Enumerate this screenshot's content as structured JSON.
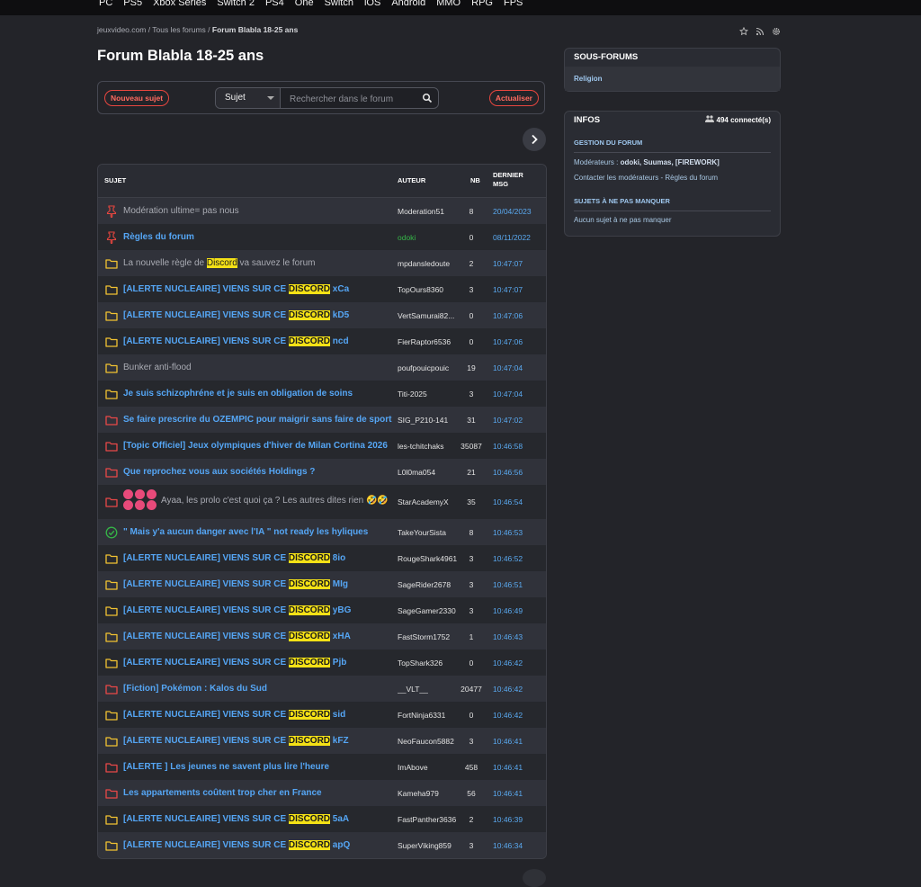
{
  "topnav": [
    "PC",
    "PS5",
    "Xbox Series",
    "Switch 2",
    "PS4",
    "One",
    "Switch",
    "iOS",
    "Android",
    "MMO",
    "RPG",
    "FPS"
  ],
  "breadcrumb": {
    "home": "jeuxvideo.com",
    "all": "Tous les forums",
    "current": "Forum Blabla 18-25 ans"
  },
  "page_title": "Forum Blabla 18-25 ans",
  "toolbar": {
    "new_topic": "Nouveau sujet",
    "select_value": "Sujet",
    "search_placeholder": "Rechercher dans le forum",
    "refresh": "Actualiser"
  },
  "table_headers": {
    "subject": "SUJET",
    "author": "AUTEUR",
    "nb": "NB",
    "last_1": "DERNIER",
    "last_2": "MSG"
  },
  "topics": [
    {
      "pre": "Modération ultime= pas nous",
      "hl": "",
      "post": "",
      "author": "Moderation51",
      "nb": "8",
      "date": "20/04/2023",
      "icon": "pin-icon",
      "style": "grey"
    },
    {
      "pre": "Règles du forum",
      "hl": "",
      "post": "",
      "author": "odoki",
      "nb": "0",
      "date": "08/11/2022",
      "icon": "pin-icon",
      "style": "blue",
      "author_style": "green"
    },
    {
      "pre": "La nouvelle règle de ",
      "hl": "Discord",
      "post": " va sauvez le forum",
      "author": "mpdansledoute",
      "nb": "2",
      "date": "10:47:07",
      "icon": "folder-yellow-icon",
      "style": "grey"
    },
    {
      "pre": "[ALERTE NUCLEAIRE] VIENS SUR CE ",
      "hl": "DISCORD",
      "post": " xCa",
      "author": "TopOurs8360",
      "nb": "3",
      "date": "10:47:07",
      "icon": "folder-yellow-icon",
      "style": "blue"
    },
    {
      "pre": "[ALERTE NUCLEAIRE] VIENS SUR CE ",
      "hl": "DISCORD",
      "post": " kD5",
      "author": "VertSamurai82...",
      "nb": "0",
      "date": "10:47:06",
      "icon": "folder-yellow-icon",
      "style": "blue"
    },
    {
      "pre": "[ALERTE NUCLEAIRE] VIENS SUR CE ",
      "hl": "DISCORD",
      "post": " ncd",
      "author": "FierRaptor6536",
      "nb": "0",
      "date": "10:47:06",
      "icon": "folder-yellow-icon",
      "style": "blue"
    },
    {
      "pre": "Bunker anti-flood",
      "hl": "",
      "post": "",
      "author": "poufpouicpouic",
      "nb": "19",
      "date": "10:47:04",
      "icon": "folder-yellow-icon",
      "style": "grey"
    },
    {
      "pre": "Je suis schizophréne et je suis en obligation de soins",
      "hl": "",
      "post": "",
      "author": "Titi-2025",
      "nb": "3",
      "date": "10:47:04",
      "icon": "folder-yellow-icon",
      "style": "blue"
    },
    {
      "pre": "Se faire prescrire du OZEMPIC pour maigrir sans faire de sport",
      "hl": "",
      "post": "",
      "author": "SIG_P210-141",
      "nb": "31",
      "date": "10:47:02",
      "icon": "folder-red-icon",
      "style": "blue"
    },
    {
      "pre": "[Topic Officiel] Jeux olympiques d'hiver de Milan Cortina 2026",
      "hl": "",
      "post": "",
      "author": "les-tchitchaks",
      "nb": "35087",
      "date": "10:46:58",
      "icon": "folder-red-icon",
      "style": "blue"
    },
    {
      "pre": "Que reprochez vous aux sociétés Holdings ?",
      "hl": "",
      "post": "",
      "author": "L0l0ma054",
      "nb": "21",
      "date": "10:46:56",
      "icon": "folder-red-icon",
      "style": "blue"
    },
    {
      "pre": "Ayaa, les prolo c'est quoi ça ? Les autres dites rien 🤣🤣",
      "hl": "",
      "post": "",
      "author": "StarAcademyX",
      "nb": "35",
      "date": "10:46:54",
      "icon": "folder-red-icon",
      "style": "grey",
      "emoji_row": true
    },
    {
      "pre": "\" Mais y'a aucun danger avec l'IA \" not ready les hyliques",
      "hl": "",
      "post": "",
      "author": "TakeYourSista",
      "nb": "8",
      "date": "10:46:53",
      "icon": "check-circle-icon",
      "style": "blue"
    },
    {
      "pre": "[ALERTE NUCLEAIRE] VIENS SUR CE ",
      "hl": "DISCORD",
      "post": " 8io",
      "author": "RougeShark4961",
      "nb": "3",
      "date": "10:46:52",
      "icon": "folder-yellow-icon",
      "style": "blue"
    },
    {
      "pre": "[ALERTE NUCLEAIRE] VIENS SUR CE ",
      "hl": "DISCORD",
      "post": " MIg",
      "author": "SageRider2678",
      "nb": "3",
      "date": "10:46:51",
      "icon": "folder-yellow-icon",
      "style": "blue"
    },
    {
      "pre": "[ALERTE NUCLEAIRE] VIENS SUR CE ",
      "hl": "DISCORD",
      "post": " yBG",
      "author": "SageGamer2330",
      "nb": "3",
      "date": "10:46:49",
      "icon": "folder-yellow-icon",
      "style": "blue"
    },
    {
      "pre": "[ALERTE NUCLEAIRE] VIENS SUR CE ",
      "hl": "DISCORD",
      "post": " xHA",
      "author": "FastStorm1752",
      "nb": "1",
      "date": "10:46:43",
      "icon": "folder-yellow-icon",
      "style": "blue"
    },
    {
      "pre": "[ALERTE NUCLEAIRE] VIENS SUR CE ",
      "hl": "DISCORD",
      "post": " Pjb",
      "author": "TopShark326",
      "nb": "0",
      "date": "10:46:42",
      "icon": "folder-yellow-icon",
      "style": "blue"
    },
    {
      "pre": "[Fiction] Pokémon : Kalos du Sud",
      "hl": "",
      "post": "",
      "author": "__VLT__",
      "nb": "20477",
      "date": "10:46:42",
      "icon": "folder-red-icon",
      "style": "blue"
    },
    {
      "pre": "[ALERTE NUCLEAIRE] VIENS SUR CE ",
      "hl": "DISCORD",
      "post": " sid",
      "author": "FortNinja6331",
      "nb": "0",
      "date": "10:46:42",
      "icon": "folder-yellow-icon",
      "style": "blue"
    },
    {
      "pre": "[ALERTE NUCLEAIRE] VIENS SUR CE ",
      "hl": "DISCORD",
      "post": " kFZ",
      "author": "NeoFaucon5882",
      "nb": "3",
      "date": "10:46:41",
      "icon": "folder-yellow-icon",
      "style": "blue"
    },
    {
      "pre": "[ALERTE ] Les jeunes ne savent plus lire l'heure",
      "hl": "",
      "post": "",
      "author": "ImAbove",
      "nb": "458",
      "date": "10:46:41",
      "icon": "folder-red-icon",
      "style": "blue"
    },
    {
      "pre": "Les appartements coûtent trop cher en France",
      "hl": "",
      "post": "",
      "author": "Kameha979",
      "nb": "56",
      "date": "10:46:41",
      "icon": "folder-red-icon",
      "style": "blue"
    },
    {
      "pre": "[ALERTE NUCLEAIRE] VIENS SUR CE ",
      "hl": "DISCORD",
      "post": " 5aA",
      "author": "FastPanther3636",
      "nb": "2",
      "date": "10:46:39",
      "icon": "folder-yellow-icon",
      "style": "blue"
    },
    {
      "pre": "[ALERTE NUCLEAIRE] VIENS SUR CE ",
      "hl": "DISCORD",
      "post": " apQ",
      "author": "SuperViking859",
      "nb": "3",
      "date": "10:46:34",
      "icon": "folder-yellow-icon",
      "style": "blue"
    }
  ],
  "subforums": {
    "title": "SOUS-FORUMS",
    "items": [
      "Religion"
    ]
  },
  "infos": {
    "title": "INFOS",
    "connected": "494 connecté(s)",
    "manage_title": "GESTION DU FORUM",
    "mods_label": "Modérateurs : ",
    "mods": "odoki, Suumas, [FIREWORK]",
    "contact": "Contacter les modérateurs",
    "sep": " - ",
    "rules": "Règles du forum",
    "must_title": "SUJETS À NE PAS MANQUER",
    "must_text": "Aucun sujet à ne pas manquer"
  },
  "colors": {
    "bg": "#232429",
    "row_a": "#30323a",
    "row_b": "#26282d",
    "link": "#55a6f5",
    "accent": "#e8463f",
    "folder_yellow": "#f1c232",
    "folder_red": "#e84848",
    "check_green": "#35b547",
    "highlight": "#f4e116"
  }
}
